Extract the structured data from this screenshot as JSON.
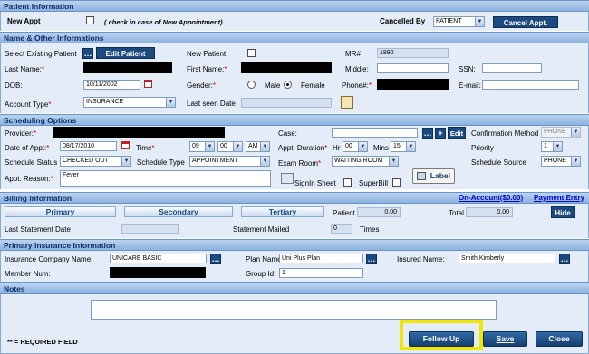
{
  "patient_info": {
    "title": "Patient Information",
    "new_appt_label": "New Appt",
    "new_appt_hint": "( check in case of New Appointment)",
    "cancelled_by_label": "Cancelled By",
    "cancelled_by_value": "PATIENT",
    "cancel_button": "Cancel Appt."
  },
  "name_other": {
    "title": "Name & Other Informations",
    "select_existing_label": "Select Existing Patient",
    "edit_patient_button": "Edit Patient",
    "new_patient_label": "New Patient",
    "mr_label": "MR#",
    "mr_value": "1890",
    "last_name_label": "Last Name:",
    "first_name_label": "First Name:",
    "middle_label": "Middle:",
    "ssn_label": "SSN:",
    "dob_label": "DOB:",
    "dob_value": "10/11/2002",
    "gender_label": "Gender:",
    "male_label": "Male",
    "female_label": "Female",
    "phone_label": "Phone#:",
    "email_label": "E-mail:",
    "account_type_label": "Account Type",
    "account_type_value": "INSURANCE",
    "last_seen_label": "Last seen Date"
  },
  "scheduling": {
    "title": "Scheduling Options",
    "provider_label": "Provider:",
    "case_label": "Case:",
    "edit_button": "Edit",
    "confirmation_label": "Confirmation Method",
    "confirmation_value": "PHONE",
    "date_label": "Date of Appt:",
    "date_value": "08/17/2010",
    "time_label": "Time",
    "time_hour": "09",
    "time_min": "00",
    "time_ampm": "AM",
    "duration_label": "Appt. Duration",
    "hr_label": "Hr",
    "hr_value": "00",
    "mins_label": "Mins",
    "mins_value": "15",
    "priority_label": "Priority",
    "priority_value": "1",
    "status_label": "Schedule Status",
    "status_value": "CHECKED OUT",
    "type_label": "Schedule Type",
    "type_value": "APPOINTMENT",
    "exam_room_label": "Exam Room",
    "exam_room_value": "WAITING ROOM",
    "source_label": "Schedule Source",
    "source_value": "PHONE",
    "reason_label": "Appt. Reason:",
    "reason_value": "Fever",
    "signin_label": "SignIn Sheet",
    "superbill_label": "SuperBill",
    "label_button": "Label"
  },
  "billing": {
    "title": "Billing Information",
    "on_account_link": "On-Account($0.00)",
    "payment_entry_link": "Payment Entry",
    "primary_tab": "Primary",
    "secondary_tab": "Secondary",
    "tertiary_tab": "Tertiary",
    "patient_label": "Patient",
    "patient_value": "0.00",
    "total_label": "Total",
    "total_value": "0.00",
    "hide_button": "Hide",
    "last_statement_label": "Last Statement Date",
    "statement_mailed_label": "Statement Mailed",
    "statement_mailed_value": "0",
    "times_label": "Times"
  },
  "primary_insurance": {
    "title": "Primary Insurance Information",
    "company_label": "Insurance Company Name:",
    "company_value": "UNICARE BASIC",
    "plan_label": "Plan Name:",
    "plan_value": "Uni Plus Plan",
    "insured_label": "Insured Name:",
    "insured_value": "Smith Kimberly",
    "member_label": "Member Num:",
    "group_label": "Group Id:",
    "group_value": "1"
  },
  "notes": {
    "title": "Notes"
  },
  "footer": {
    "required_note": "* = REQUIRED FIELD",
    "follow_up_button": "Follow Up",
    "save_button": "Save",
    "close_button": "Close"
  },
  "colors": {
    "header_text": "#0f2e6b",
    "button_bg": "#1c4a7e",
    "required": "#cc0000",
    "highlight": "#f2e600"
  }
}
